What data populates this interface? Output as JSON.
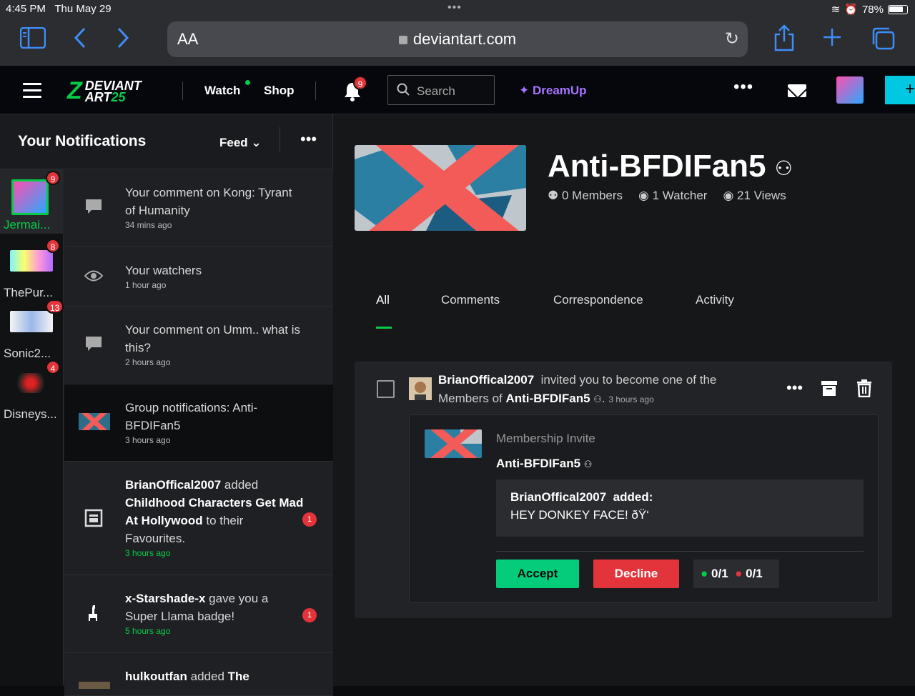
{
  "ios": {
    "time": "4:45 PM",
    "date": "Thu May 29",
    "battery": "78%"
  },
  "safari": {
    "aa": "AA",
    "url": "deviantart.com"
  },
  "nav": {
    "logo_line1": "DEVIANT",
    "logo_line2": "ART",
    "logo_25": "25",
    "watch": "Watch",
    "shop": "Shop",
    "bell_badge": "9",
    "search_placeholder": "Search",
    "dreamup": "DreamUp",
    "submit": "+"
  },
  "notifications": {
    "title": "Your Notifications",
    "feed_label": "Feed",
    "senders": [
      {
        "name": "Jermai...",
        "badge": "9"
      },
      {
        "name": "ThePur...",
        "badge": "8"
      },
      {
        "name": "Sonic2...",
        "badge": "13"
      },
      {
        "name": "Disneys...",
        "badge": "4"
      }
    ],
    "items": [
      {
        "text": "Your comment on Kong: Tyrant of Humanity",
        "time": "34 mins ago"
      },
      {
        "text": "Your watchers",
        "time": "1 hour ago"
      },
      {
        "text": "Your comment on Umm.. what is this?",
        "time": "2 hours ago"
      },
      {
        "text": "Group notifications: Anti-BFDIFan5",
        "time": "3 hours ago"
      },
      {
        "user": "BrianOffical2007",
        "action": "added",
        "target": "Childhood Characters Get Mad At Hollywood",
        "rest": "to their Favourites.",
        "time": "3 hours ago",
        "count": "1"
      },
      {
        "user": "x-Starshade-x",
        "action": "gave you a Super Llama badge!",
        "time": "5 hours ago",
        "count": "1"
      },
      {
        "user": "hulkoutfan",
        "action": "added",
        "target": "The"
      }
    ]
  },
  "group": {
    "name": "Anti-BFDIFan5",
    "members": "0 Members",
    "watchers": "1 Watcher",
    "views": "21 Views"
  },
  "tabs": [
    "All",
    "Comments",
    "Correspondence",
    "Activity"
  ],
  "card": {
    "user": "BrianOffical2007",
    "text1": "invited you to become one of the",
    "text2": "Members of",
    "group": "Anti-BFDIFan5",
    "time": "3 hours ago",
    "invite_label": "Membership Invite",
    "invite_group": "Anti-BFDIFan5",
    "msg_user": "BrianOffical2007",
    "msg_action": "added:",
    "msg_text": "HEY DONKEY FACE! ðŸ‘",
    "accept": "Accept",
    "decline": "Decline",
    "votes_yes": "0/1",
    "votes_no": "0/1"
  }
}
